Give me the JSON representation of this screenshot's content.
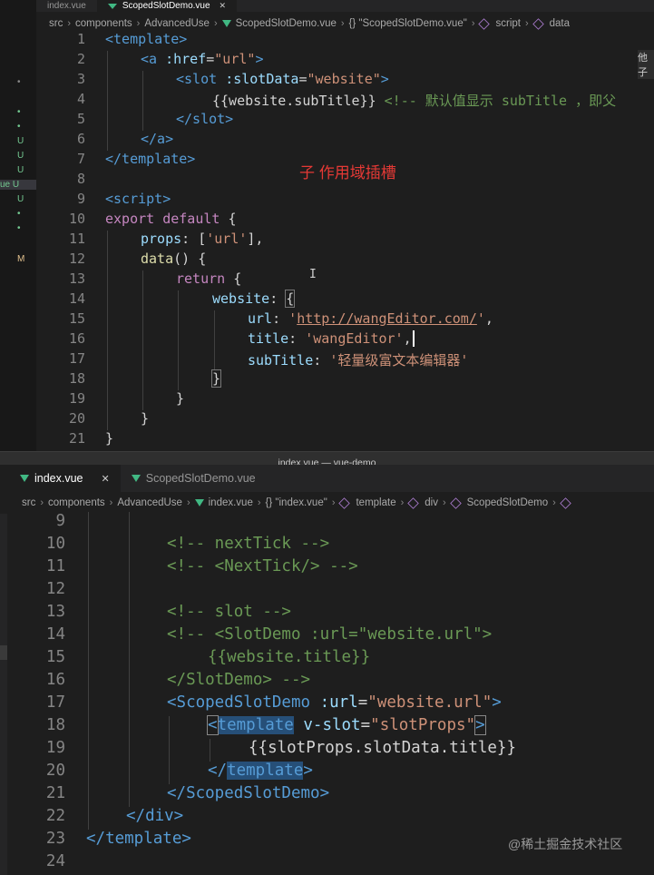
{
  "top_editor": {
    "tabs": [
      {
        "label": "index.vue",
        "active": false
      },
      {
        "label": "ScopedSlotDemo.vue",
        "active": true
      }
    ],
    "breadcrumb": [
      "src",
      "components",
      "AdvancedUse",
      "ScopedSlotDemo.vue",
      "{} \"ScopedSlotDemo.vue\"",
      "script",
      "data"
    ],
    "right_edge_text": "他子",
    "annotation": "子 作用域插槽",
    "gutter_markers": [
      "•",
      "•",
      "•",
      "U",
      "U",
      "U",
      "ue U",
      "U",
      "•",
      "•",
      "M"
    ],
    "line_numbers": [
      "1",
      "2",
      "3",
      "4",
      "5",
      "6",
      "7",
      "8",
      "9",
      "10",
      "11",
      "12",
      "13",
      "14",
      "15",
      "16",
      "17",
      "18",
      "19",
      "20",
      "21"
    ]
  },
  "bottom_editor": {
    "window_title": "index.vue — vue-demo",
    "tabs": [
      {
        "label": "index.vue",
        "active": true
      },
      {
        "label": "ScopedSlotDemo.vue",
        "active": false
      }
    ],
    "breadcrumb": [
      "src",
      "components",
      "AdvancedUse",
      "index.vue",
      "{} \"index.vue\"",
      "template",
      "div",
      "ScopedSlotDemo"
    ],
    "line_numbers": [
      "9",
      "10",
      "11",
      "12",
      "13",
      "14",
      "15",
      "16",
      "17",
      "18",
      "19",
      "20",
      "21",
      "22",
      "23",
      "24"
    ]
  },
  "watermark": "@稀土掘金技术社区",
  "code_top": {
    "l1": "<template>",
    "l2a": "<a ",
    "l2b": ":href",
    "l2c": "=",
    "l2d": "\"url\"",
    "l2e": ">",
    "l3a": "<slot ",
    "l3b": ":slotData",
    "l3c": "=",
    "l3d": "\"website\"",
    "l3e": ">",
    "l4a": "{{website.subTitle}}",
    "l4b": " <!-- 默认值显示 subTitle ，即父",
    "l5": "</slot>",
    "l6": "</a>",
    "l7": "</template>",
    "l9": "<script>",
    "l10a": "export default",
    "l10b": " {",
    "l11a": "props",
    "l11b": ": [",
    "l11c": "'url'",
    "l11d": "],",
    "l12a": "data",
    "l12b": "() {",
    "l13a": "return",
    "l13b": " {",
    "l14a": "website",
    "l14b": ": ",
    "l14c": "{",
    "l15a": "url",
    "l15b": ": ",
    "l15c": "'",
    "l15d": "http://wangEditor.com/",
    "l15e": "'",
    "l15f": ",",
    "l16a": "title",
    "l16b": ": ",
    "l16c": "'wangEditor'",
    "l16d": ",",
    "l17a": "subTitle",
    "l17b": ": ",
    "l17c": "'轻量级富文本编辑器'",
    "l18": "}",
    "l19": "}",
    "l20": "}",
    "l21": "}"
  },
  "code_bottom": {
    "l10": "<!-- nextTick -->",
    "l11": "<!-- <NextTick/> -->",
    "l13": "<!-- slot -->",
    "l14": "<!-- <SlotDemo :url=\"website.url\">",
    "l15": "{{website.title}}",
    "l16": "</SlotDemo> -->",
    "l17a": "<ScopedSlotDemo",
    "l17b": " :url",
    "l17c": "=",
    "l17d": "\"website.url\"",
    "l17e": ">",
    "l18a": "<",
    "l18b": "template",
    "l18c": " v-slot",
    "l18d": "=",
    "l18e": "\"slotProps\"",
    "l18f": ">",
    "l19": "{{slotProps.slotData.title}}",
    "l20a": "</",
    "l20b": "template",
    "l20c": ">",
    "l21": "</ScopedSlotDemo>",
    "l22": "</div>",
    "l23": "</template>"
  }
}
